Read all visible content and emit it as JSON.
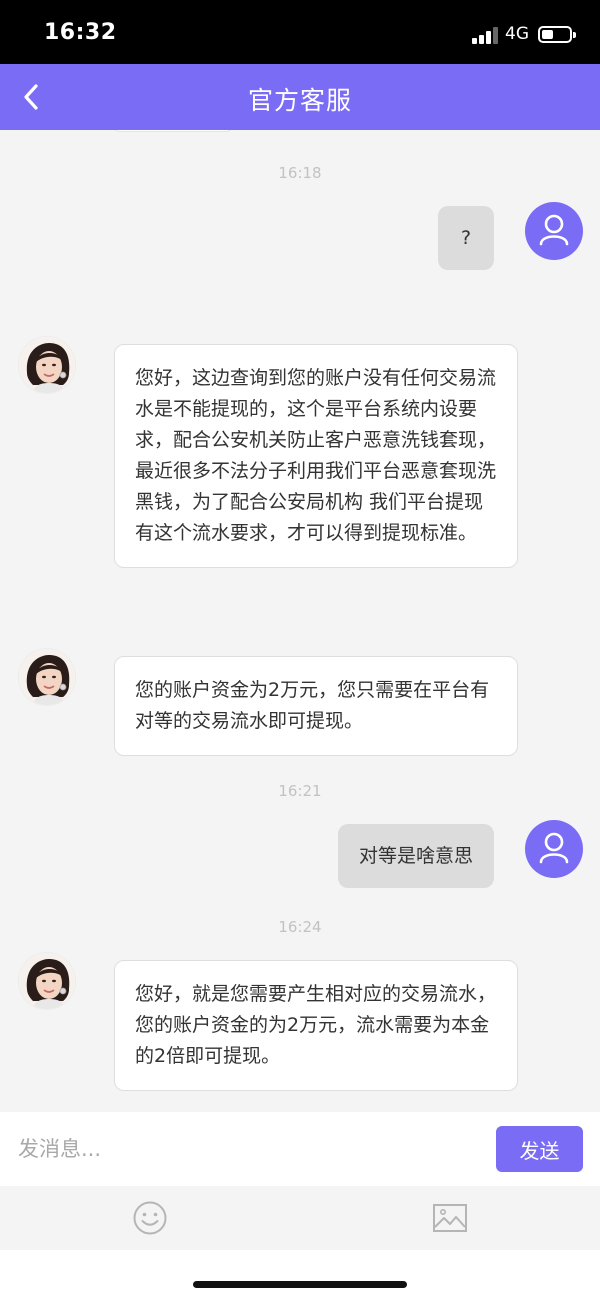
{
  "status_bar": {
    "time": "16:32",
    "network": "4G"
  },
  "header": {
    "title": "官方客服",
    "back_icon": "chevron-left-icon"
  },
  "colors": {
    "accent": "#7b6cf6",
    "outgoing_bubble": "#dcdcdc",
    "incoming_bubble": "#ffffff",
    "timestamp": "#c2c2c2"
  },
  "messages": {
    "ts1": "16:18",
    "user1": "?",
    "agent1": "您好，这边查询到您的账户没有任何交易流水是不能提现的，这个是平台系统内设要求，配合公安机关防止客户恶意洗钱套现，最近很多不法分子利用我们平台恶意套现洗黑钱，为了配合公安局机构 我们平台提现有这个流水要求，才可以得到提现标准。",
    "agent2": "您的账户资金为2万元，您只需要在平台有对等的交易流水即可提现。",
    "ts2": "16:21",
    "user2": "对等是啥意思",
    "ts3": "16:24",
    "agent3": "您好，就是您需要产生相对应的交易流水，您的账户资金的为2万元，流水需要为本金的2倍即可提现。"
  },
  "input": {
    "placeholder": "发消息...",
    "value": "",
    "send_label": "发送"
  },
  "toolbar": {
    "emoji_icon": "smiley-icon",
    "image_icon": "image-icon"
  }
}
